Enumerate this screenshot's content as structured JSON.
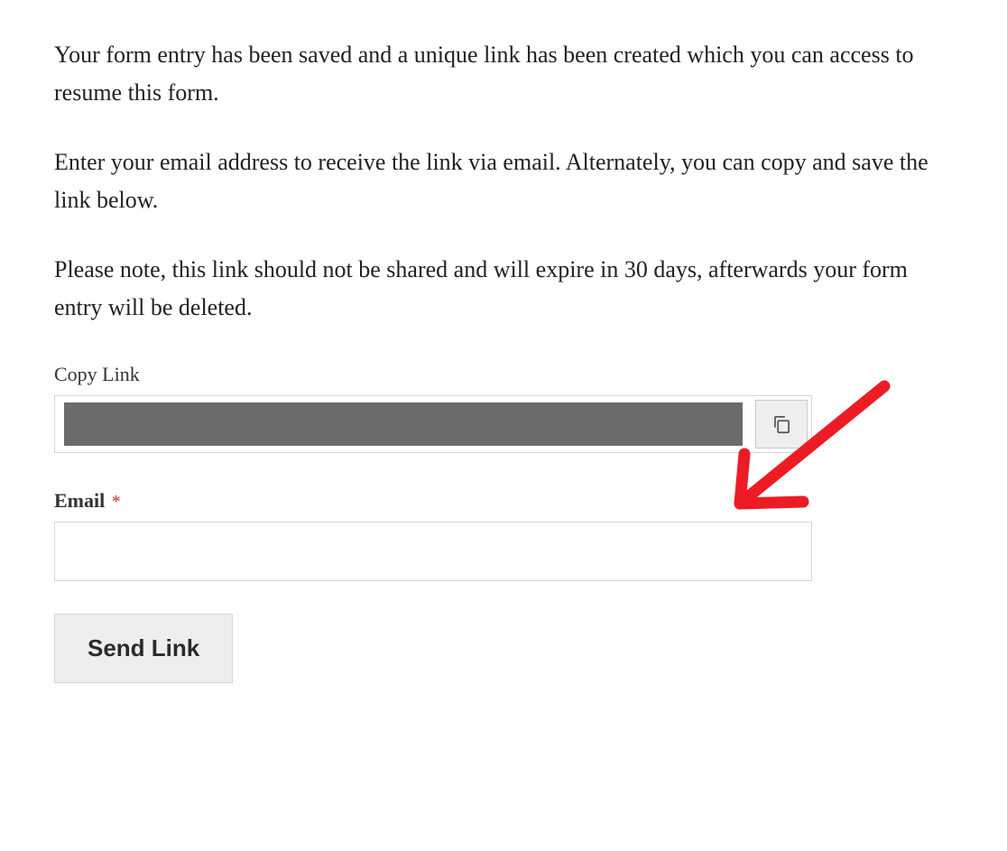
{
  "intro": {
    "paragraph1": "Your form entry has been saved and a unique link has been created which you can access to resume this form.",
    "paragraph2": "Enter your email address to receive the link via email. Alternately, you can copy and save the link below.",
    "paragraph3": "Please note, this link should not be shared and will expire in 30 days, afterwards your form entry will be deleted."
  },
  "copyLink": {
    "label": "Copy Link",
    "value": ""
  },
  "email": {
    "label": "Email",
    "required": "*",
    "value": ""
  },
  "button": {
    "sendLink": "Send Link"
  }
}
